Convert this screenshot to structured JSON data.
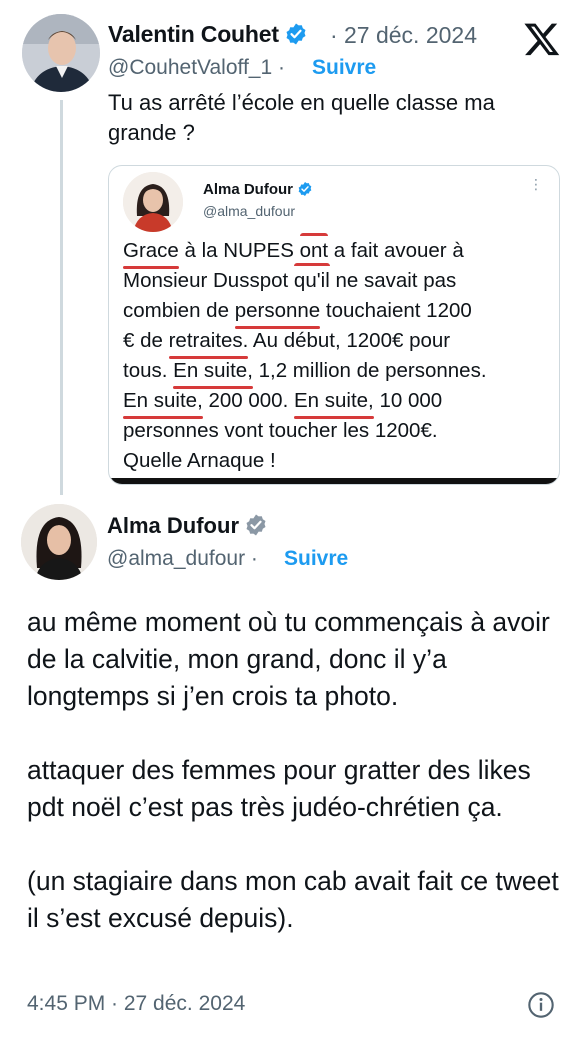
{
  "tweet1": {
    "author_name": "Valentin Couhet",
    "separator": "·",
    "date": "27 déc. 2024",
    "handle": "@CouhetValoff_1 ·",
    "follow_label": "Suivre",
    "text": "Tu as arrêté l’école en quelle classe ma grande ?",
    "platform_icon": "x-logo-icon",
    "verified_color": "#1d9bf0"
  },
  "quoted": {
    "author_name": "Alma Dufour",
    "handle": "@alma_dufour",
    "more": "⋮",
    "lines": [
      [
        "Grace",
        " à la NUPES ",
        "ont",
        " a fait avouer à"
      ],
      [
        "Monsieur Dusspot ",
        "qu'il",
        " ne savait pas"
      ],
      [
        "combien de ",
        "personne",
        " touchaient 1200"
      ],
      [
        "€ de ",
        "retraites.",
        " Au début, 1200€ pour"
      ],
      [
        "tous. ",
        "En suite,",
        " 1,2 million de personnes."
      ],
      [
        "En suite,",
        " 200 000. ",
        "En suite,",
        " 10 000"
      ],
      [
        "personnes vont toucher les 1200€."
      ],
      [
        "Quelle Arnaque !"
      ]
    ],
    "underline_color": "#d63a3a"
  },
  "tweet2": {
    "author_name": "Alma Dufour",
    "handle": "@alma_dufour ·",
    "follow_label": "Suivre",
    "paragraphs": [
      "au même moment où tu commençais à avoir de la calvitie, mon grand, donc il y’a longtemps si j’en crois ta photo.",
      "attaquer des femmes pour gratter des likes pdt noël c’est pas très judéo-chrétien ça.",
      "(un stagiaire dans mon cab avait fait ce tweet il s’est excusé depuis)."
    ],
    "timestamp": "4:45 PM · 27 déc. 2024",
    "verified_color": "#8b98a5"
  },
  "colors": {
    "link": "#1d9bf0",
    "secondary_text": "#536471",
    "border": "#cfd9de"
  }
}
